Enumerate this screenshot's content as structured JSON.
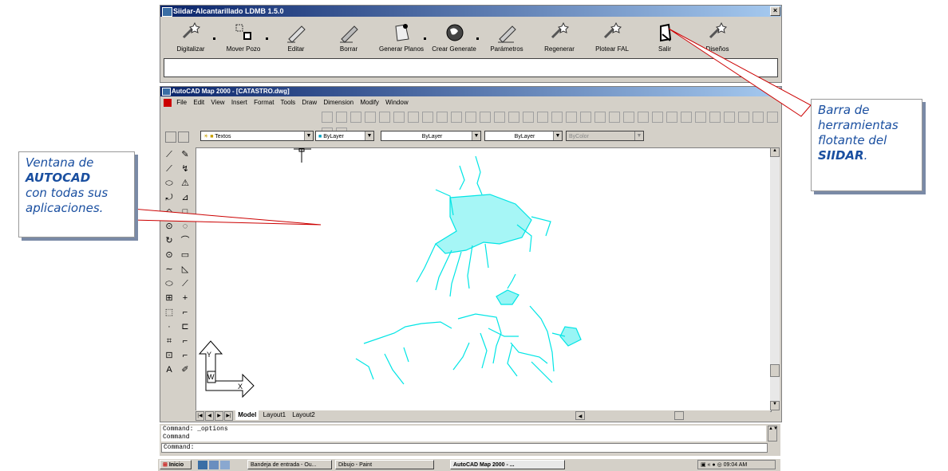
{
  "siidar_toolbar": {
    "title": "Siidar-Alcantarillado LDMB 1.5.0",
    "close": "×",
    "buttons": [
      {
        "label": "Digitalizar",
        "icon": "wand-icon"
      },
      {
        "label": "Mover Pozo",
        "icon": "move-icon"
      },
      {
        "label": "Editar",
        "icon": "pencil-icon"
      },
      {
        "label": "Borrar",
        "icon": "pencil-erase-icon"
      },
      {
        "label": "Generar Planos",
        "icon": "plans-icon"
      },
      {
        "label": "Crear Generate",
        "icon": "globe-icon"
      },
      {
        "label": "Parámetros",
        "icon": "pencil-params-icon"
      },
      {
        "label": "Regenerar",
        "icon": "wand-regen-icon"
      },
      {
        "label": "Plotear FAL",
        "icon": "wand-plot-icon"
      },
      {
        "label": "Salir",
        "icon": "exit-icon"
      },
      {
        "label": "Diseños",
        "icon": "wand-design-icon"
      }
    ]
  },
  "autocad": {
    "title": "AutoCAD Map 2000 - [CATASTRO.dwg]",
    "close": "×",
    "menu": [
      "File",
      "Edit",
      "View",
      "Insert",
      "Format",
      "Tools",
      "Draw",
      "Dimension",
      "Modify",
      "Window"
    ],
    "layer_combo": "Textos",
    "color_combo": "ByLayer",
    "linetype_combo": "ByLayer",
    "lineweight_combo": "ByLayer",
    "plotstyle_combo": "ByColor",
    "tabs": [
      "Model",
      "Layout1",
      "Layout2"
    ],
    "ucs_y": "Y",
    "ucs_w": "W",
    "ucs_x": "X"
  },
  "command_lines": [
    "Command:  _options",
    "Command",
    "Command:"
  ],
  "taskbar": {
    "start": "Inicio",
    "tasks": [
      "Bandeja de entrada - Ou...",
      "Dibujo - Paint",
      "AutoCAD Map 2000 - ..."
    ],
    "clock": "09:04 AM"
  },
  "callouts": {
    "left": {
      "line1": "Ventana de",
      "line2": "AUTOCAD",
      "line3": "con todas sus",
      "line4": "aplicaciones."
    },
    "right": {
      "line1": "Barra de",
      "line2": "herramientas",
      "line3": "flotante del",
      "line4": "SIIDAR",
      "line4_suffix": "."
    }
  },
  "colors": {
    "drawing": "#00e5e5",
    "callout_text": "#1a4fa0",
    "arrow": "#cc0000",
    "titlebar": "#0a246a"
  }
}
